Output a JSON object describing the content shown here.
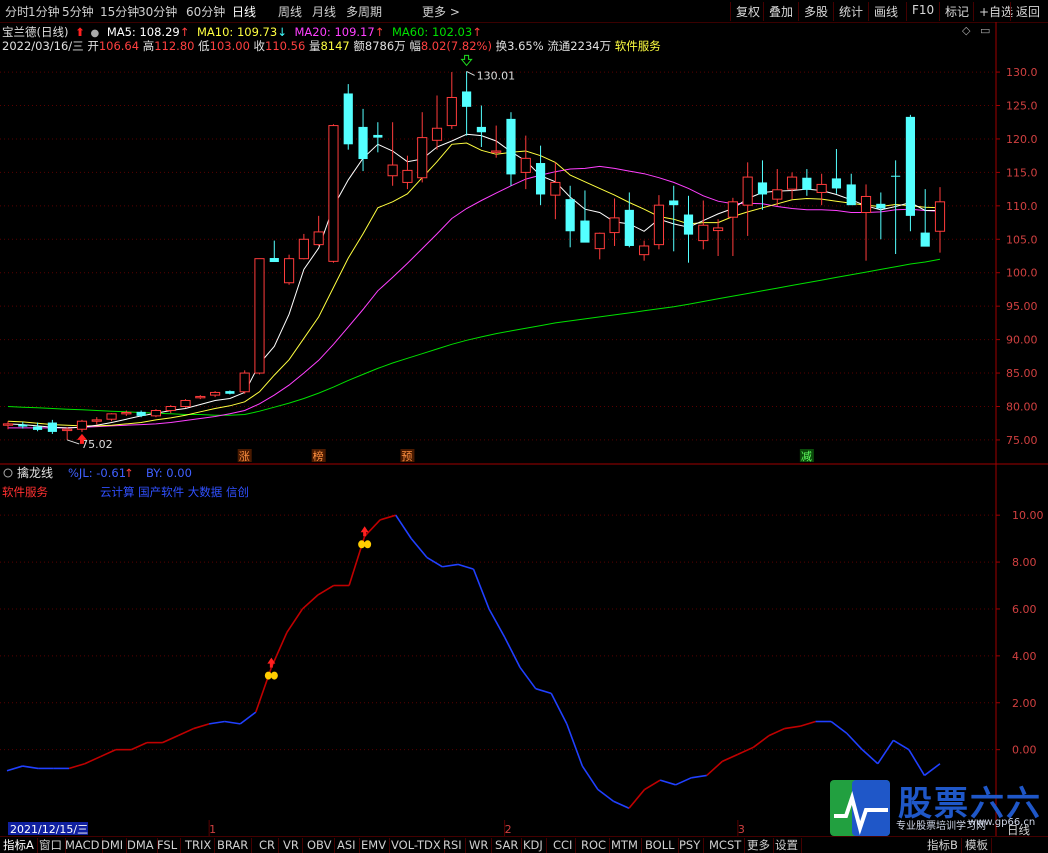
{
  "toolbar": {
    "left": [
      "分时",
      "1分钟",
      "5分钟",
      "15分钟",
      "30分钟",
      "60分钟",
      "日线",
      "周线",
      "月线",
      "多周期",
      "更多 >"
    ],
    "active_index": 6,
    "right": [
      "复权",
      "叠加",
      "多股",
      "统计",
      "画线",
      "F10",
      "标记",
      "+自选",
      "返回"
    ]
  },
  "info": {
    "stock_title": "宝兰德(日线)",
    "ma5": "MA5: 108.29",
    "ma10": "MA10: 109.73",
    "ma20": "MA20: 109.17",
    "ma60": "MA60: 102.03",
    "date": "2022/03/16/三",
    "open_label": "开",
    "open": "106.64",
    "high_label": "高",
    "high": "112.80",
    "low_label": "低",
    "low": "103.00",
    "close_label": "收",
    "close": "110.56",
    "vol_label": "量",
    "vol": "8147",
    "amt_label": "额",
    "amt": "8786万",
    "chg_label": "幅",
    "chg": "8.02(7.82%)",
    "turnover": "换3.65%",
    "float": "流通2234万",
    "sector": "软件服务"
  },
  "colors": {
    "up": "#ff3c3c",
    "down": "#54ffff",
    "ma5": "#ffffff",
    "ma10": "#ffff40",
    "ma20": "#ff40ff",
    "ma60": "#00e000",
    "axis": "#a00000",
    "ind_red": "#c00000",
    "ind_blue": "#2040ff"
  },
  "chart_data": [
    {
      "type": "candlestick",
      "ylim": [
        72,
        133
      ],
      "yticks": [
        "130.0",
        "125.0",
        "120.0",
        "115.0",
        "110.0",
        "105.0",
        "100.0",
        "95.00",
        "90.00",
        "85.00",
        "80.00",
        "75.00"
      ],
      "ytick_values": [
        130,
        125,
        120,
        115,
        110,
        105,
        100,
        95,
        90,
        85,
        80,
        75
      ],
      "annotations": {
        "high": "130.01",
        "low": "75.02"
      },
      "tags": [
        "涨",
        "榜",
        "预",
        "减"
      ],
      "tag_index": [
        16,
        21,
        27,
        54
      ],
      "up_arrow_index": [
        5
      ],
      "down_arrow_index": [
        31
      ],
      "candles": [
        [
          77.2,
          77.8,
          76.6,
          77.4
        ],
        [
          77.3,
          77.7,
          76.7,
          77.0
        ],
        [
          77.0,
          77.6,
          76.3,
          76.5
        ],
        [
          77.6,
          78.0,
          75.9,
          76.2
        ],
        [
          76.4,
          76.9,
          75.0,
          76.6
        ],
        [
          76.6,
          78.0,
          76.2,
          77.8
        ],
        [
          77.8,
          78.4,
          77.3,
          78.0
        ],
        [
          78.1,
          79.0,
          77.8,
          78.9
        ],
        [
          78.9,
          79.4,
          78.6,
          79.1
        ],
        [
          79.2,
          79.4,
          78.4,
          78.6
        ],
        [
          78.6,
          79.6,
          78.4,
          79.4
        ],
        [
          79.4,
          80.2,
          79.0,
          80.0
        ],
        [
          80.0,
          81.1,
          79.8,
          80.9
        ],
        [
          81.3,
          81.7,
          81.1,
          81.5
        ],
        [
          81.7,
          82.3,
          81.4,
          82.1
        ],
        [
          82.3,
          82.4,
          81.8,
          81.9
        ],
        [
          82.2,
          85.4,
          81.9,
          85.0
        ],
        [
          85.0,
          99.2,
          84.8,
          102.1
        ],
        [
          102.2,
          104.8,
          101.8,
          101.6
        ],
        [
          98.5,
          102.7,
          98.2,
          102.1
        ],
        [
          102.1,
          105.8,
          102.0,
          105.0
        ],
        [
          104.2,
          108.5,
          104.0,
          106.1
        ],
        [
          101.7,
          122.2,
          101.5,
          122.0
        ],
        [
          126.8,
          128.2,
          118.4,
          119.2
        ],
        [
          121.8,
          124.5,
          115.2,
          117.0
        ],
        [
          120.6,
          122.5,
          118.0,
          120.2
        ],
        [
          114.5,
          122.5,
          113.0,
          116.1
        ],
        [
          113.5,
          117.5,
          112.5,
          115.3
        ],
        [
          114.2,
          124.0,
          113.5,
          120.2
        ],
        [
          119.8,
          126.5,
          118.4,
          121.6
        ],
        [
          122.0,
          130.0,
          121.5,
          126.2
        ],
        [
          127.1,
          130.1,
          120.5,
          124.8
        ],
        [
          121.8,
          125.0,
          118.8,
          121.0
        ],
        [
          118.0,
          122.0,
          117.2,
          118.2
        ],
        [
          123.0,
          124.0,
          113.0,
          114.7
        ],
        [
          115.0,
          120.5,
          112.5,
          117.1
        ],
        [
          116.4,
          119.0,
          110.1,
          111.7
        ],
        [
          111.6,
          116.5,
          108.0,
          113.5
        ],
        [
          111.0,
          113.0,
          103.8,
          106.2
        ],
        [
          107.8,
          112.3,
          105.0,
          104.5
        ],
        [
          103.6,
          106.0,
          102.0,
          105.9
        ],
        [
          106.0,
          111.1,
          104.0,
          108.2
        ],
        [
          109.4,
          112.0,
          103.8,
          104.0
        ],
        [
          102.7,
          104.8,
          101.8,
          104.0
        ],
        [
          104.2,
          111.6,
          103.5,
          110.1
        ],
        [
          110.8,
          113.0,
          103.2,
          110.1
        ],
        [
          108.7,
          111.5,
          101.5,
          105.7
        ],
        [
          104.8,
          110.8,
          103.5,
          107.1
        ],
        [
          106.3,
          108.0,
          102.5,
          106.7
        ],
        [
          108.3,
          111.2,
          102.5,
          110.6
        ],
        [
          110.1,
          116.5,
          105.5,
          114.3
        ],
        [
          113.5,
          116.8,
          109.4,
          111.7
        ],
        [
          111.0,
          115.5,
          110.0,
          112.4
        ],
        [
          112.5,
          115.0,
          111.0,
          114.3
        ],
        [
          114.2,
          115.5,
          111.5,
          112.4
        ],
        [
          112.0,
          114.8,
          110.1,
          113.2
        ],
        [
          114.1,
          118.5,
          111.8,
          112.6
        ],
        [
          113.2,
          114.8,
          111.3,
          110.1
        ],
        [
          109.0,
          113.2,
          101.8,
          111.4
        ],
        [
          110.3,
          112.0,
          105.0,
          109.6
        ],
        [
          114.5,
          116.8,
          102.8,
          114.4
        ],
        [
          123.3,
          123.6,
          106.2,
          108.5
        ],
        [
          106.0,
          112.5,
          104.0,
          103.9
        ],
        [
          106.2,
          112.8,
          103.0,
          110.6
        ]
      ],
      "ma5": [
        77.4,
        77.3,
        77.1,
        76.9,
        76.8,
        76.9,
        77.2,
        77.6,
        78.1,
        78.6,
        79.0,
        79.4,
        79.7,
        80.3,
        80.9,
        81.2,
        82.1,
        86.4,
        89.0,
        93.8,
        100.5,
        103.7,
        109.9,
        113.9,
        117.1,
        119.2,
        118.2,
        116.6,
        117.0,
        118.8,
        119.7,
        120.7,
        120.5,
        119.7,
        118.1,
        116.7,
        114.5,
        113.6,
        111.3,
        109.5,
        109.0,
        107.6,
        107.3,
        106.2,
        108.0,
        107.3,
        106.8,
        107.8,
        108.8,
        109.6,
        111.1,
        112.0,
        112.2,
        112.3,
        112.5,
        112.3,
        111.7,
        110.9,
        110.0,
        109.4,
        109.9,
        110.5,
        109.3,
        109.3
      ],
      "ma10": [
        77.8,
        77.7,
        77.5,
        77.3,
        77.2,
        77.1,
        77.1,
        77.2,
        77.4,
        77.6,
        78.0,
        78.3,
        78.7,
        79.2,
        79.7,
        80.1,
        80.7,
        82.2,
        84.7,
        87.0,
        90.2,
        93.4,
        97.8,
        102.2,
        105.8,
        109.7,
        110.6,
        111.8,
        114.2,
        116.6,
        119.2,
        119.4,
        118.3,
        117.7,
        118.0,
        118.2,
        117.5,
        116.5,
        114.6,
        113.6,
        112.6,
        111.6,
        110.5,
        109.5,
        108.4,
        108.0,
        107.3,
        107.5,
        107.5,
        108.4,
        109.1,
        109.7,
        110.3,
        110.9,
        111.1,
        111.0,
        110.7,
        110.4,
        110.1,
        109.9,
        110.2,
        110.0,
        109.8,
        109.7
      ],
      "ma20": [
        76.8,
        76.8,
        76.8,
        76.8,
        76.8,
        76.9,
        77.0,
        77.1,
        77.2,
        77.3,
        77.4,
        77.6,
        77.9,
        78.2,
        78.5,
        78.9,
        79.4,
        80.4,
        81.7,
        83.2,
        85.0,
        86.9,
        89.3,
        91.9,
        94.5,
        97.3,
        99.3,
        101.4,
        103.6,
        105.8,
        108.1,
        109.6,
        110.8,
        111.9,
        113.0,
        114.0,
        114.6,
        115.1,
        115.5,
        115.6,
        115.9,
        115.6,
        115.2,
        114.8,
        114.2,
        113.5,
        112.6,
        111.5,
        110.7,
        110.3,
        110.4,
        110.3,
        109.9,
        109.6,
        109.4,
        109.4,
        109.3,
        109.0,
        109.0,
        109.1,
        109.4,
        109.5,
        109.3,
        109.2
      ],
      "ma60": [
        80.0,
        79.9,
        79.8,
        79.7,
        79.6,
        79.5,
        79.4,
        79.3,
        79.2,
        79.1,
        79.0,
        78.9,
        78.8,
        78.8,
        78.7,
        78.7,
        78.8,
        79.3,
        79.9,
        80.5,
        81.2,
        82.0,
        82.9,
        83.9,
        84.8,
        85.7,
        86.5,
        87.2,
        87.9,
        88.6,
        89.3,
        89.9,
        90.4,
        90.9,
        91.3,
        91.7,
        92.1,
        92.5,
        92.8,
        93.1,
        93.4,
        93.7,
        94.0,
        94.3,
        94.6,
        94.9,
        95.3,
        95.7,
        96.1,
        96.5,
        96.9,
        97.3,
        97.7,
        98.1,
        98.5,
        98.9,
        99.3,
        99.7,
        100.1,
        100.5,
        100.9,
        101.3,
        101.6,
        102.0
      ]
    },
    {
      "type": "line",
      "title": "擒龙线",
      "series_labels": [
        {
          "name": "%JL",
          "value": "-0.61"
        },
        {
          "name": "BY",
          "value": "0.00"
        }
      ],
      "sector_text": "软件服务",
      "concept_text": "云计算 国产软件 大数据 信创",
      "ylim": [
        -3,
        11.5
      ],
      "yticks": [
        "10.00",
        "8.00",
        "6.00",
        "4.00",
        "2.00",
        "0.00"
      ],
      "ytick_values": [
        10,
        8,
        6,
        4,
        2,
        0
      ],
      "values": [
        -0.9,
        -0.7,
        -0.8,
        -0.8,
        -0.8,
        -0.6,
        -0.3,
        0.0,
        0.0,
        0.3,
        0.3,
        0.6,
        0.9,
        1.1,
        1.2,
        1.1,
        1.6,
        3.5,
        5.0,
        6.0,
        6.6,
        7.0,
        7.0,
        9.1,
        9.8,
        10.0,
        9.0,
        8.2,
        7.8,
        7.9,
        7.7,
        6.0,
        4.8,
        3.5,
        2.6,
        2.4,
        1.1,
        -0.7,
        -1.7,
        -2.2,
        -2.5,
        -1.7,
        -1.3,
        -1.5,
        -1.2,
        -1.1,
        -0.5,
        -0.2,
        0.1,
        0.6,
        0.9,
        1.0,
        1.2,
        1.2,
        0.7,
        0.0,
        -0.6,
        0.4,
        0.0,
        -1.1,
        -0.6
      ],
      "colors_by_point": [
        "b",
        "b",
        "b",
        "b",
        "b",
        "r",
        "r",
        "r",
        "r",
        "r",
        "r",
        "r",
        "r",
        "r",
        "b",
        "b",
        "b",
        "r",
        "r",
        "r",
        "r",
        "r",
        "r",
        "r",
        "r",
        "r",
        "b",
        "b",
        "b",
        "b",
        "b",
        "b",
        "b",
        "b",
        "b",
        "b",
        "b",
        "b",
        "b",
        "b",
        "b",
        "r",
        "r",
        "b",
        "b",
        "b",
        "r",
        "r",
        "r",
        "r",
        "r",
        "r",
        "r",
        "b",
        "b",
        "b",
        "b",
        "b",
        "b",
        "b",
        "b"
      ],
      "signals": [
        17,
        23
      ],
      "date_label": "2021/12/15/三",
      "month_ticks": [
        "1",
        "2",
        "3"
      ],
      "month_tick_index": [
        13,
        32,
        47
      ]
    }
  ],
  "tabs": [
    "指标A",
    "窗口",
    "MACD",
    "DMI",
    "DMA",
    "FSL",
    "TRIX",
    "BRAR",
    "CR",
    "VR",
    "OBV",
    "ASI",
    "EMV",
    "VOL-TDX",
    "RSI",
    "WR",
    "SAR",
    "KDJ",
    "CCI",
    "ROC",
    "MTM",
    "BOLL",
    "PSY",
    "MCST",
    "更多",
    "设置"
  ],
  "tabs_right": [
    "指标B",
    "模板"
  ],
  "period_label": "日线",
  "logo": {
    "text": "股票六六",
    "url": "www.gp66.cn",
    "sub": "专业股票培训学习网"
  }
}
